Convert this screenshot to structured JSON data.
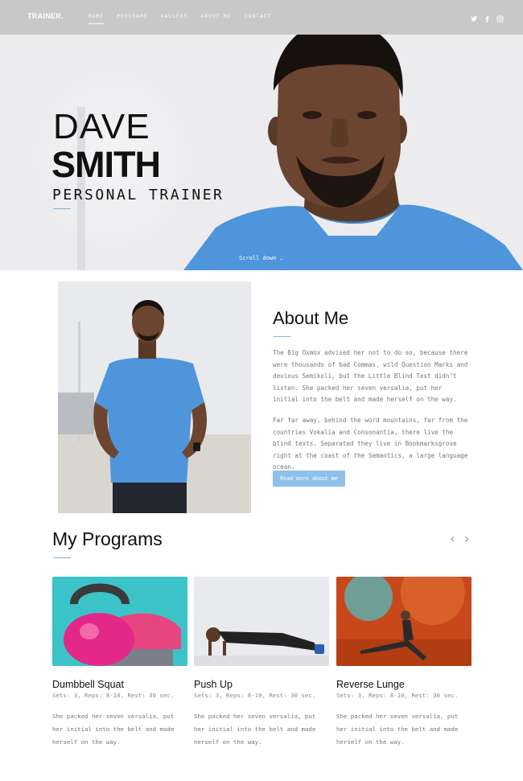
{
  "brand": "TRAINER.",
  "nav": {
    "items": [
      "HOME",
      "PROGRAMS",
      "GALLERY",
      "ABOUT ME",
      "CONTACT"
    ],
    "active": "HOME"
  },
  "social": [
    "twitter-icon",
    "facebook-icon",
    "instagram-icon"
  ],
  "hero": {
    "first_name": "DAVE",
    "last_name": "SMITH",
    "role": "PERSONAL TRAINER",
    "scroll_label": "Scroll down"
  },
  "about": {
    "title": "About Me",
    "paragraphs": [
      "The Big Oxmox advised her not to do so, because there were thousands of bad Commas, wild Question Marks and devious Semikoli, but the Little Blind Text didn’t listen. She packed her seven versalia, put her initial into the belt and made herself on the way.",
      "Far far away, behind the word mountains, far from the countries Vokalia and Consonantia, there live the blind texts. Separated they live in Bookmarksgrove right at the coast of the Semantics, a large language ocean."
    ],
    "button": "Read more about me"
  },
  "programs": {
    "title": "My Programs",
    "cards": [
      {
        "title": "Dumbbell Squat",
        "meta": "Sets: 3, Reps: 8-10, Rest: 30 sec.",
        "desc": "She packed her seven versalia, put her initial into the belt and made herself on the way."
      },
      {
        "title": "Push Up",
        "meta": "Sets: 3, Reps: 8-10, Rest: 30 sec.",
        "desc": "She packed her seven versalia, put her initial into the belt and made herself on the way."
      },
      {
        "title": "Reverse Lunge",
        "meta": "Sets: 3, Reps: 8-10, Rest: 30 sec.",
        "desc": "She packed her seven versalia, put her initial into the belt and made herself on the way."
      }
    ]
  },
  "colors": {
    "accent": "#8ec0ea",
    "shirt": "#4f95dc",
    "nav_bg": "#c8c8c8"
  }
}
